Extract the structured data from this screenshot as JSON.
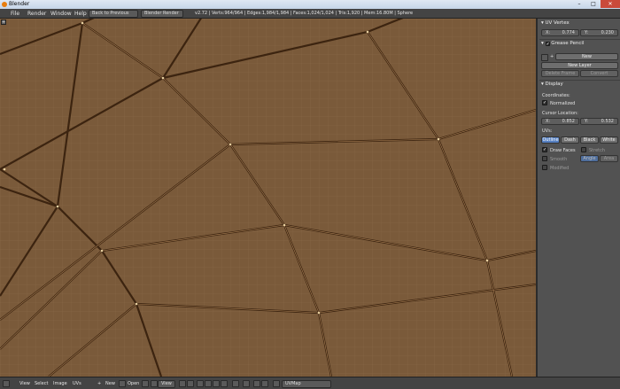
{
  "window": {
    "title": "Blender",
    "min_label": "–",
    "max_label": "□",
    "close_label": "✕"
  },
  "info_header": {
    "menus": [
      "File",
      "Render",
      "Window",
      "Help"
    ],
    "back_button": "Back to Previous",
    "render_engine": "Blender Render",
    "stats": "v2.72 | Verts:964/964 | Edges:1,984/1,984 | Faces:1,024/1,024 | Tris:1,920 | Mem:16.80M | Sphere"
  },
  "panel": {
    "uv_vertex": {
      "header": "UV Vertex",
      "x_label": "X:",
      "x_value": "0.774",
      "y_label": "Y:",
      "y_value": "0.230"
    },
    "grease_pencil": {
      "header": "Grease Pencil",
      "new_label": "New",
      "new_layer_label": "New Layer",
      "delete_frame_label": "Delete Frame",
      "convert_label": "Convert"
    },
    "display": {
      "header": "Display",
      "coordinates_label": "Coordinates:",
      "normalized_label": "Normalized",
      "cursor_label": "Cursor Location:",
      "cx_label": "X:",
      "cx_value": "0.852",
      "cy_label": "Y:",
      "cy_value": "0.532",
      "uvs_label": "UVs:",
      "uv_modes": [
        "Outline",
        "Dash",
        "Black",
        "White"
      ],
      "draw_faces_label": "Draw Faces",
      "stretch_label": "Stretch",
      "smooth_label": "Smooth",
      "angle_label": "Angle",
      "area_label": "Area",
      "modified_label": "Modified"
    }
  },
  "bottom_header": {
    "menus": [
      "View",
      "Select",
      "Image",
      "UVs"
    ],
    "new_label": "New",
    "open_label": "Open",
    "view_label": "View",
    "uvmap_label": "UVMap"
  },
  "colors": {
    "uv_fill": "#7a5a3a",
    "grid_line": "#8a6a48",
    "edge_color": "#3c2410",
    "highlight": "#5680c2"
  }
}
